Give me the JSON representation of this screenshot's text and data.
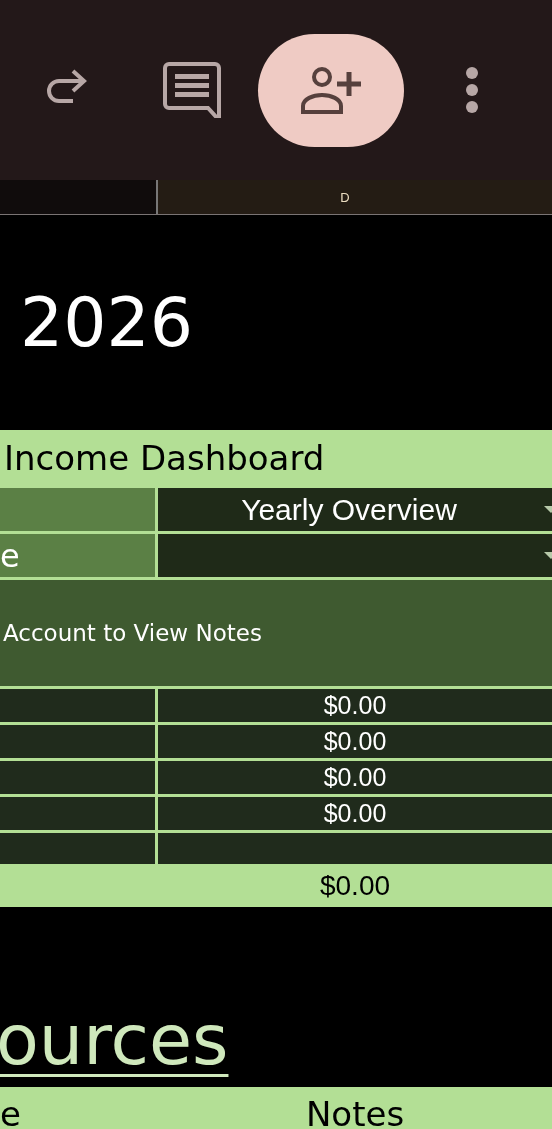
{
  "toolbar": {
    "buttons": [
      {
        "kind": "redo",
        "filled": false
      },
      {
        "kind": "comment",
        "filled": false
      },
      {
        "kind": "share",
        "filled": true
      },
      {
        "kind": "more",
        "filled": false
      }
    ]
  },
  "column_header": "D",
  "year": "2026",
  "dashboard": {
    "title": "Income Dashboard",
    "view_select": {
      "value": "Yearly Overview"
    },
    "second_select": {
      "label": "e"
    },
    "notes": "Account to View Notes",
    "rows": [
      {
        "kind": "amount",
        "amount": "$0.00"
      },
      {
        "kind": "amount",
        "amount": "$0.00"
      },
      {
        "kind": "amount",
        "amount": "$0.00"
      },
      {
        "kind": "amount",
        "amount": "$0.00"
      },
      {
        "kind": "blank"
      }
    ],
    "total": "$0.00"
  },
  "section_heading": "ources",
  "table": {
    "columns": [
      "e",
      "Notes"
    ]
  }
}
